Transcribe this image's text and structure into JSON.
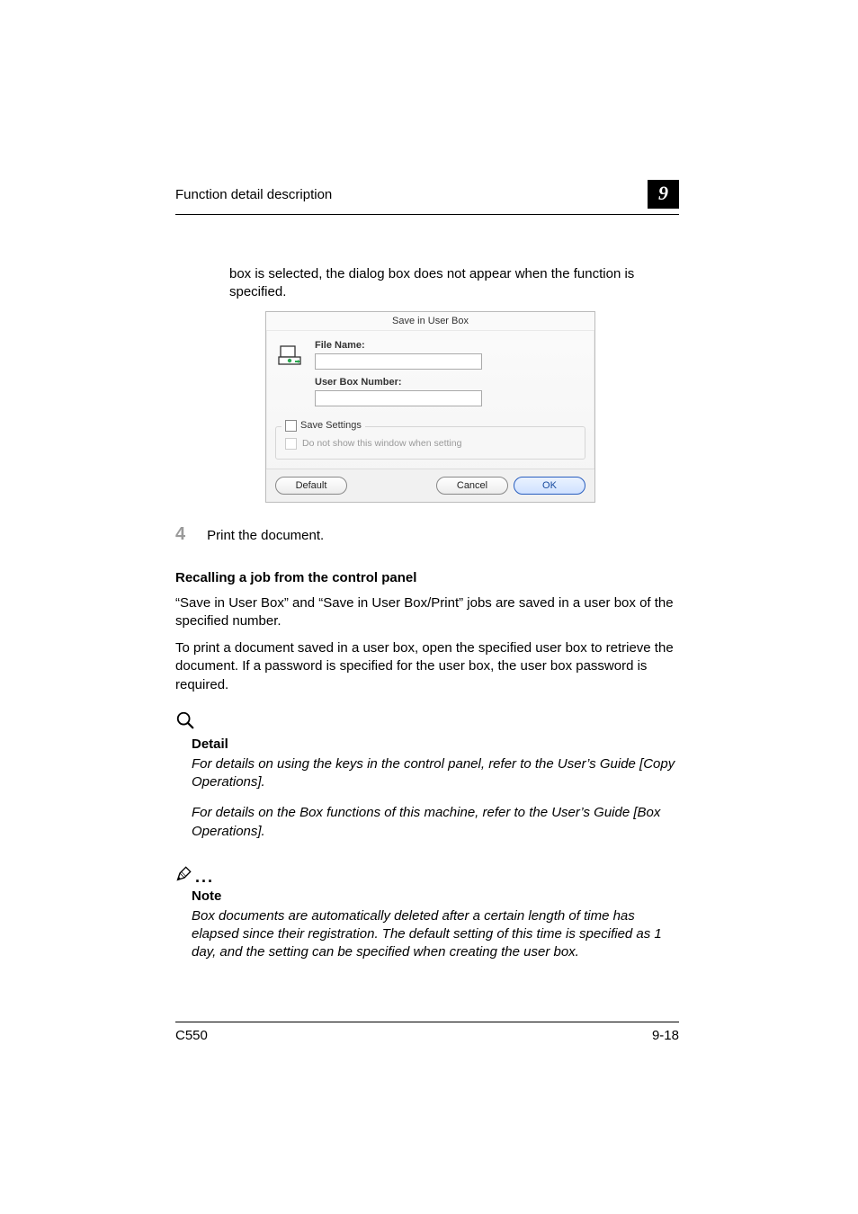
{
  "header": {
    "title": "Function detail description",
    "chapter": "9"
  },
  "intro_para": "box is selected, the dialog box does not appear when the function is specified.",
  "dialog": {
    "title": "Save in User Box",
    "file_name_label": "File Name:",
    "file_name_value": "",
    "user_box_label": "User Box Number:",
    "user_box_value": "",
    "save_settings_label": "Save Settings",
    "do_not_show_label": "Do not show this window when setting",
    "default_btn": "Default",
    "cancel_btn": "Cancel",
    "ok_btn": "OK"
  },
  "step4": {
    "num": "4",
    "text": "Print the document."
  },
  "subheading": "Recalling a job from the control panel",
  "para1": "“Save in User Box” and “Save in User Box/Print” jobs are saved in a user box of the specified number.",
  "para2": "To print a document saved in a user box, open the specified user box to retrieve the document. If a password is specified for the user box, the user box password is required.",
  "detail": {
    "head": "Detail",
    "p1": "For details on using the keys in the control panel, refer to the User’s Guide [Copy Operations].",
    "p2": "For details on the Box functions of this machine, refer to the User’s Guide [Box Operations]."
  },
  "note": {
    "head": "Note",
    "p1": "Box documents are automatically deleted after a certain length of time has elapsed since their registration. The default setting of this time is specified as 1 day, and the setting can be specified when creating the user box."
  },
  "footer": {
    "model": "C550",
    "page": "9-18"
  }
}
